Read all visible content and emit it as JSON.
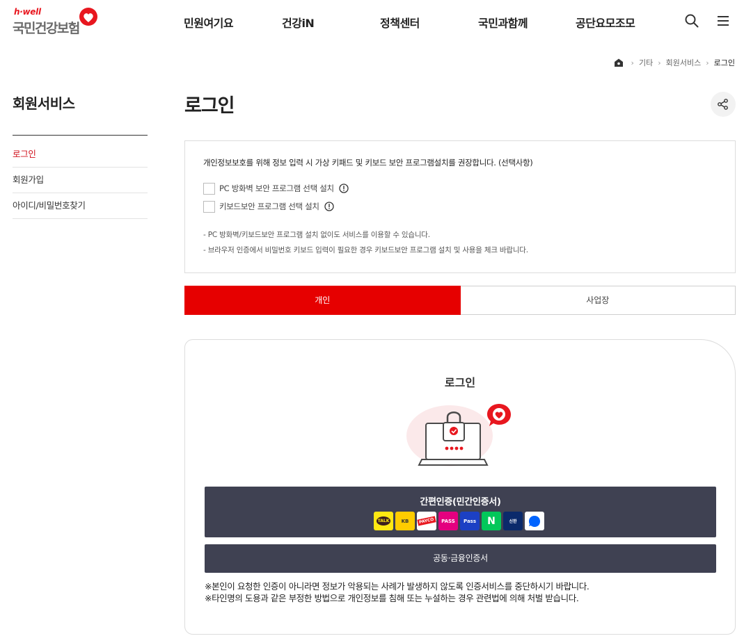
{
  "header": {
    "logo_brand": "h·well",
    "logo_name": "국민건강보험",
    "nav": [
      "민원여기요",
      "건강iN",
      "정책센터",
      "국민과함께",
      "공단요모조모"
    ]
  },
  "breadcrumb": {
    "items": [
      "기타",
      "회원서비스",
      "로그인"
    ]
  },
  "sidebar": {
    "title": "회원서비스",
    "items": [
      {
        "label": "로그인",
        "active": true
      },
      {
        "label": "회원가입",
        "active": false
      },
      {
        "label": "아이디/비밀번호찾기",
        "active": false
      }
    ]
  },
  "main": {
    "title": "로그인",
    "notice": {
      "heading": "개인정보보호를 위해 정보 입력 시 가상 키패드 및 키보드 보안 프로그램설치를 권장합니다. (선택사항)",
      "checkbox1": "PC 방화벽 보안 프로그램 선택 설치",
      "checkbox2": "키보드보안 프로그램 선택 설치",
      "note1": "- PC 방화벽/키보드보안 프로그램 설치 없이도 서비스를 이용할 수 있습니다.",
      "note2": "- 브라우저 인증에서 비밀번호 키보드 입력이 필요한 경우 키보드보안 프로그램 설치 및 사용을 체크 바랍니다."
    },
    "tabs": [
      "개인",
      "사업장"
    ],
    "login": {
      "title": "로그인",
      "simple_auth": "간편인증(민간인증서)",
      "cert_icons": [
        {
          "name": "kakao-icon",
          "label": "TALK"
        },
        {
          "name": "kb-icon",
          "label": "KB"
        },
        {
          "name": "payco-icon",
          "label": "PAYCO"
        },
        {
          "name": "pass-icon",
          "label": "PASS"
        },
        {
          "name": "samsung-pass-icon",
          "label": "Pass"
        },
        {
          "name": "naver-icon",
          "label": "N"
        },
        {
          "name": "shinhan-icon",
          "label": "신한"
        },
        {
          "name": "toss-icon",
          "label": ""
        }
      ],
      "public_cert": "공동·금융인증서",
      "warning1": "※본인이 요청한 인증이 아니라면 정보가 악용되는 사례가 발생하지 않도록 인증서비스를 중단하시기 바랍니다.",
      "warning2": "※타인명의 도용과 같은 부정한 방법으로 개인정보를 침해 또는 누설하는 경우 관련법에 의해 처벌 받습니다."
    }
  },
  "colors": {
    "accent": "#e60000",
    "button": "#3f4152"
  }
}
